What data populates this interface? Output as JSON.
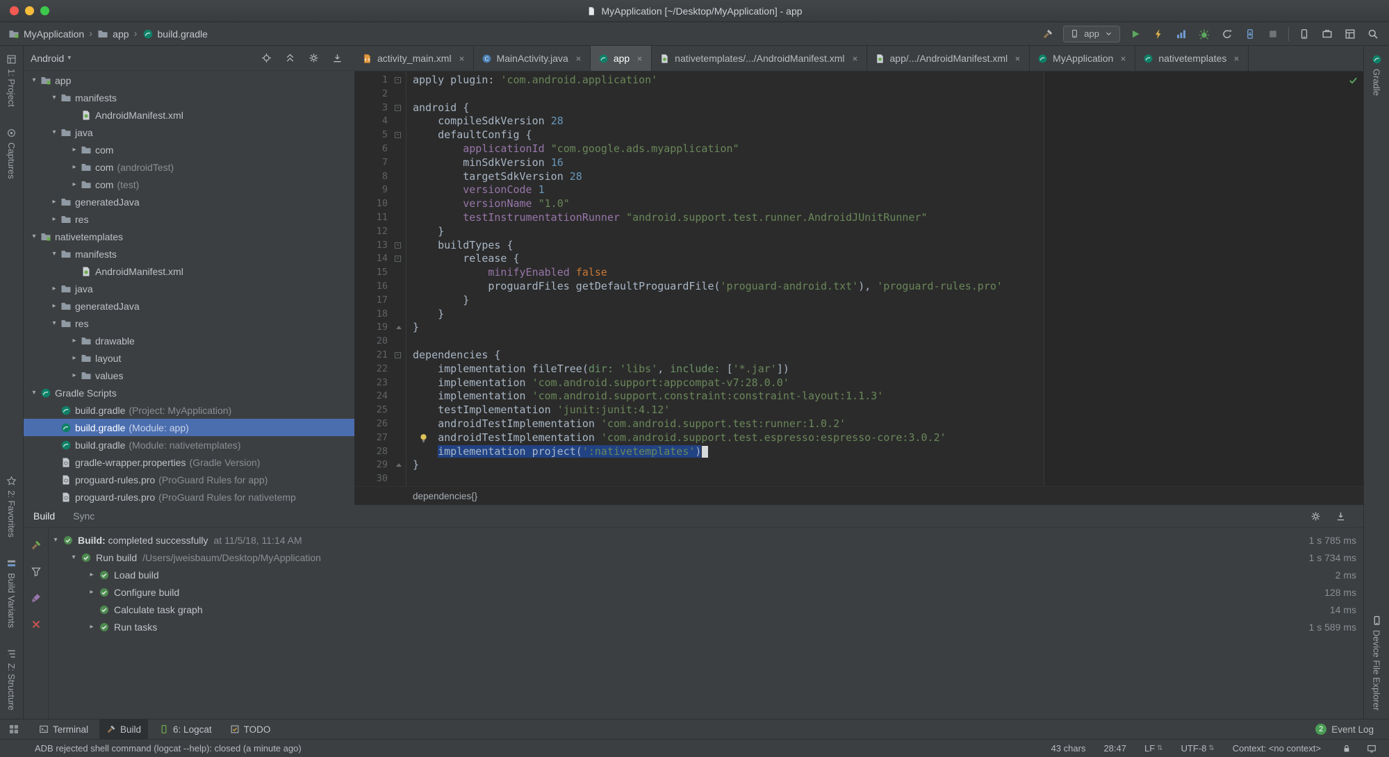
{
  "colors": {
    "editor_bg": "#2b2b2b",
    "panel_bg": "#3c3f41",
    "selection_blue": "#4b6eaf",
    "editor_selection": "#214283",
    "accent_green": "#499c54",
    "error_red": "#c75450",
    "keyword_orange": "#cc7832",
    "string_green": "#6a8759",
    "number_blue": "#6897bb",
    "field_purple": "#9876aa",
    "ui_text": "#bbbbbb",
    "code_text": "#a9b7c6",
    "gutter_text": "#606366",
    "dim_text": "#8a8f94"
  },
  "titlebar": {
    "title": "MyApplication [~/Desktop/MyApplication] - app"
  },
  "toolbar": {
    "breadcrumbs": [
      {
        "label": "MyApplication",
        "icon": "module"
      },
      {
        "label": "app",
        "icon": "folder"
      },
      {
        "label": "build.gradle",
        "icon": "gradle"
      }
    ],
    "run_config": {
      "label": "app",
      "icon": "avd-manager"
    },
    "icons_left_of_config": [
      "hammer"
    ],
    "icons_after_config": [
      "play",
      "apply-changes",
      "profiler",
      "debug",
      "gradle-sync",
      "attach-debugger",
      "stop"
    ],
    "icons_right": [
      "avd-manager",
      "sdk-manager",
      "layout-inspector",
      "search"
    ]
  },
  "left_strip": {
    "top": [
      {
        "label": "1: Project",
        "icon": "strip-project"
      },
      {
        "label": "Captures",
        "icon": "strip-captures"
      }
    ],
    "bottom": [
      {
        "label": "2: Favorites",
        "icon": "strip-favorites"
      },
      {
        "label": "Build Variants",
        "icon": "strip-variants"
      },
      {
        "label": "Z: Structure",
        "icon": "strip-structure"
      }
    ]
  },
  "right_strip": {
    "top": [
      {
        "label": "Gradle",
        "icon": "gradle"
      }
    ],
    "bottom": [
      {
        "label": "Device File Explorer",
        "icon": "avd-manager"
      }
    ]
  },
  "project_panel": {
    "selector": "Android",
    "header_icons": [
      "locate",
      "collapse-all",
      "gear",
      "hide"
    ],
    "tree": [
      {
        "level": 0,
        "arrow": "open",
        "icon": "module",
        "label": "app",
        "suffix": ""
      },
      {
        "level": 1,
        "arrow": "open",
        "icon": "folder",
        "label": "manifests",
        "suffix": ""
      },
      {
        "level": 2,
        "arrow": "none",
        "icon": "manifest",
        "label": "AndroidManifest.xml",
        "suffix": ""
      },
      {
        "level": 1,
        "arrow": "open",
        "icon": "folder",
        "label": "java",
        "suffix": ""
      },
      {
        "level": 2,
        "arrow": "closed",
        "icon": "folder",
        "label": "com",
        "suffix": ""
      },
      {
        "level": 2,
        "arrow": "closed",
        "icon": "folder",
        "label": "com",
        "suffix": "(androidTest)"
      },
      {
        "level": 2,
        "arrow": "closed",
        "icon": "folder",
        "label": "com",
        "suffix": "(test)"
      },
      {
        "level": 1,
        "arrow": "closed",
        "icon": "folder",
        "label": "generatedJava",
        "suffix": ""
      },
      {
        "level": 1,
        "arrow": "closed",
        "icon": "folder",
        "label": "res",
        "suffix": ""
      },
      {
        "level": 0,
        "arrow": "open",
        "icon": "module",
        "label": "nativetemplates",
        "suffix": ""
      },
      {
        "level": 1,
        "arrow": "open",
        "icon": "folder",
        "label": "manifests",
        "suffix": ""
      },
      {
        "level": 2,
        "arrow": "none",
        "icon": "manifest",
        "label": "AndroidManifest.xml",
        "suffix": ""
      },
      {
        "level": 1,
        "arrow": "closed",
        "icon": "folder",
        "label": "java",
        "suffix": ""
      },
      {
        "level": 1,
        "arrow": "closed",
        "icon": "folder",
        "label": "generatedJava",
        "suffix": ""
      },
      {
        "level": 1,
        "arrow": "open",
        "icon": "folder",
        "label": "res",
        "suffix": ""
      },
      {
        "level": 2,
        "arrow": "closed",
        "icon": "folder",
        "label": "drawable",
        "suffix": ""
      },
      {
        "level": 2,
        "arrow": "closed",
        "icon": "folder",
        "label": "layout",
        "suffix": ""
      },
      {
        "level": 2,
        "arrow": "closed",
        "icon": "folder",
        "label": "values",
        "suffix": ""
      },
      {
        "level": 0,
        "arrow": "open",
        "icon": "gradle",
        "label": "Gradle Scripts",
        "suffix": ""
      },
      {
        "level": 1,
        "arrow": "none",
        "icon": "gradle",
        "label": "build.gradle",
        "suffix": "(Project: MyApplication)"
      },
      {
        "level": 1,
        "arrow": "none",
        "icon": "gradle",
        "label": "build.gradle",
        "suffix": "(Module: app)",
        "selected": true
      },
      {
        "level": 1,
        "arrow": "none",
        "icon": "gradle",
        "label": "build.gradle",
        "suffix": "(Module: nativetemplates)"
      },
      {
        "level": 1,
        "arrow": "none",
        "icon": "config",
        "label": "gradle-wrapper.properties",
        "suffix": "(Gradle Version)"
      },
      {
        "level": 1,
        "arrow": "none",
        "icon": "config",
        "label": "proguard-rules.pro",
        "suffix": "(ProGuard Rules for app)"
      },
      {
        "level": 1,
        "arrow": "none",
        "icon": "config",
        "label": "proguard-rules.pro",
        "suffix": "(ProGuard Rules for nativetemp"
      }
    ]
  },
  "editor": {
    "tabs": [
      {
        "label": "activity_main.xml",
        "icon": "xmlfile",
        "active": false
      },
      {
        "label": "MainActivity.java",
        "icon": "classfile",
        "active": false
      },
      {
        "label": "app",
        "icon": "gradle",
        "active": true
      },
      {
        "label": "nativetemplates/.../AndroidManifest.xml",
        "icon": "manifest",
        "active": false
      },
      {
        "label": "app/.../AndroidManifest.xml",
        "icon": "manifest",
        "active": false
      },
      {
        "label": "MyApplication",
        "icon": "gradle",
        "active": false
      },
      {
        "label": "nativetemplates",
        "icon": "gradle",
        "active": false
      }
    ],
    "breadcrumb": "dependencies{}",
    "code": [
      {
        "n": 1,
        "fold": "start",
        "seg": [
          [
            "p",
            "apply plugin: "
          ],
          [
            "s",
            "'com.android.application'"
          ]
        ]
      },
      {
        "n": 2,
        "seg": []
      },
      {
        "n": 3,
        "fold": "start",
        "seg": [
          [
            "p",
            "android {"
          ]
        ]
      },
      {
        "n": 4,
        "seg": [
          [
            "p",
            "    compileSdkVersion "
          ],
          [
            "n",
            "28"
          ]
        ]
      },
      {
        "n": 5,
        "fold": "start",
        "seg": [
          [
            "p",
            "    defaultConfig {"
          ]
        ]
      },
      {
        "n": 6,
        "seg": [
          [
            "p",
            "        "
          ],
          [
            "f",
            "applicationId "
          ],
          [
            "s",
            "\"com.google.ads.myapplication\""
          ]
        ]
      },
      {
        "n": 7,
        "seg": [
          [
            "p",
            "        minSdkVersion "
          ],
          [
            "n",
            "16"
          ]
        ]
      },
      {
        "n": 8,
        "seg": [
          [
            "p",
            "        targetSdkVersion "
          ],
          [
            "n",
            "28"
          ]
        ]
      },
      {
        "n": 9,
        "seg": [
          [
            "p",
            "        "
          ],
          [
            "f",
            "versionCode "
          ],
          [
            "n",
            "1"
          ]
        ]
      },
      {
        "n": 10,
        "seg": [
          [
            "p",
            "        "
          ],
          [
            "f",
            "versionName "
          ],
          [
            "s",
            "\"1.0\""
          ]
        ]
      },
      {
        "n": 11,
        "seg": [
          [
            "p",
            "        "
          ],
          [
            "f",
            "testInstrumentationRunner "
          ],
          [
            "s",
            "\"android.support.test.runner.AndroidJUnitRunner\""
          ]
        ]
      },
      {
        "n": 12,
        "seg": [
          [
            "p",
            "    }"
          ]
        ]
      },
      {
        "n": 13,
        "fold": "start",
        "seg": [
          [
            "p",
            "    buildTypes {"
          ]
        ]
      },
      {
        "n": 14,
        "fold": "start",
        "seg": [
          [
            "p",
            "        release {"
          ]
        ]
      },
      {
        "n": 15,
        "seg": [
          [
            "p",
            "            "
          ],
          [
            "f",
            "minifyEnabled "
          ],
          [
            "k",
            "false"
          ]
        ]
      },
      {
        "n": 16,
        "seg": [
          [
            "p",
            "            proguardFiles getDefaultProguardFile("
          ],
          [
            "s",
            "'proguard-android.txt'"
          ],
          [
            "p",
            "), "
          ],
          [
            "s",
            "'proguard-rules.pro'"
          ]
        ]
      },
      {
        "n": 17,
        "seg": [
          [
            "p",
            "        }"
          ]
        ]
      },
      {
        "n": 18,
        "seg": [
          [
            "p",
            "    }"
          ]
        ]
      },
      {
        "n": 19,
        "fold": "end",
        "seg": [
          [
            "p",
            "}"
          ]
        ]
      },
      {
        "n": 20,
        "seg": []
      },
      {
        "n": 21,
        "fold": "start",
        "seg": [
          [
            "p",
            "dependencies {"
          ]
        ]
      },
      {
        "n": 22,
        "seg": [
          [
            "p",
            "    implementation fileTree("
          ],
          [
            "m",
            "dir: "
          ],
          [
            "s",
            "'libs'"
          ],
          [
            "p",
            ", "
          ],
          [
            "m",
            "include: "
          ],
          [
            "p",
            "["
          ],
          [
            "s",
            "'*.jar'"
          ],
          [
            "p",
            "])"
          ]
        ]
      },
      {
        "n": 23,
        "seg": [
          [
            "p",
            "    implementation "
          ],
          [
            "s",
            "'com.android.support:appcompat-v7:28.0.0'"
          ]
        ]
      },
      {
        "n": 24,
        "seg": [
          [
            "p",
            "    implementation "
          ],
          [
            "s",
            "'com.android.support.constraint:constraint-layout:1.1.3'"
          ]
        ]
      },
      {
        "n": 25,
        "seg": [
          [
            "p",
            "    testImplementation "
          ],
          [
            "s",
            "'junit:junit:4.12'"
          ]
        ]
      },
      {
        "n": 26,
        "seg": [
          [
            "p",
            "    androidTestImplementation "
          ],
          [
            "s",
            "'com.android.support.test:runner:1.0.2'"
          ]
        ]
      },
      {
        "n": 27,
        "bulb": true,
        "seg": [
          [
            "p",
            "    androidTestImplementation "
          ],
          [
            "s",
            "'com.android.support.test.espresso:espresso-core:3.0.2'"
          ]
        ]
      },
      {
        "n": 28,
        "sel": true,
        "indent": "    ",
        "seg": [
          [
            "p",
            "implementation project("
          ],
          [
            "s",
            "':nativetemplates'"
          ],
          [
            "p",
            ")"
          ]
        ]
      },
      {
        "n": 29,
        "fold": "end",
        "seg": [
          [
            "p",
            "}"
          ]
        ]
      },
      {
        "n": 30,
        "seg": []
      }
    ]
  },
  "build_panel": {
    "tabs": [
      {
        "label": "Build",
        "active": true
      },
      {
        "label": "Sync",
        "active": false
      }
    ],
    "header_icons": [
      "gear",
      "import"
    ],
    "side_icons": [
      "hammer-green",
      "funnel",
      "brush",
      "close-red"
    ],
    "rows": [
      {
        "level": 0,
        "arrow": "open",
        "icon": "status-ok",
        "bold": "Build:",
        "label": " completed successfully",
        "detail": "at 11/5/18, 11:14 AM",
        "time": "1 s 785 ms"
      },
      {
        "level": 1,
        "arrow": "open",
        "icon": "status-ok",
        "bold": "",
        "label": "Run build",
        "detail": "/Users/jweisbaum/Desktop/MyApplication",
        "time": "1 s 734 ms"
      },
      {
        "level": 2,
        "arrow": "closed",
        "icon": "status-ok",
        "bold": "",
        "label": "Load build",
        "detail": "",
        "time": "2 ms"
      },
      {
        "level": 2,
        "arrow": "closed",
        "icon": "status-ok",
        "bold": "",
        "label": "Configure build",
        "detail": "",
        "time": "128 ms"
      },
      {
        "level": 2,
        "arrow": "none",
        "icon": "status-ok",
        "bold": "",
        "label": "Calculate task graph",
        "detail": "",
        "time": "14 ms"
      },
      {
        "level": 2,
        "arrow": "closed",
        "icon": "status-ok",
        "bold": "",
        "label": "Run tasks",
        "detail": "",
        "time": "1 s 589 ms"
      }
    ]
  },
  "bottom_bar": {
    "switcher_icon": "switcher",
    "tabs": [
      {
        "label": "Terminal",
        "icon": "terminal",
        "active": false
      },
      {
        "label": "Build",
        "icon": "hammer",
        "active": true
      },
      {
        "label": "6: Logcat",
        "icon": "logcat",
        "active": false
      },
      {
        "label": "TODO",
        "icon": "todo",
        "active": false
      }
    ],
    "event_log": {
      "label": "Event Log",
      "badge": "2"
    }
  },
  "status_bar": {
    "message": "ADB rejected shell command (logcat --help): closed (a minute ago)",
    "items": [
      {
        "text": "43 chars",
        "arrows": false
      },
      {
        "text": "28:47",
        "arrows": false
      },
      {
        "text": "LF",
        "arrows": true
      },
      {
        "text": "UTF-8",
        "arrows": true
      },
      {
        "text": "Context: <no context>",
        "arrows": false
      }
    ],
    "icons": [
      "lock",
      "monitor"
    ]
  }
}
